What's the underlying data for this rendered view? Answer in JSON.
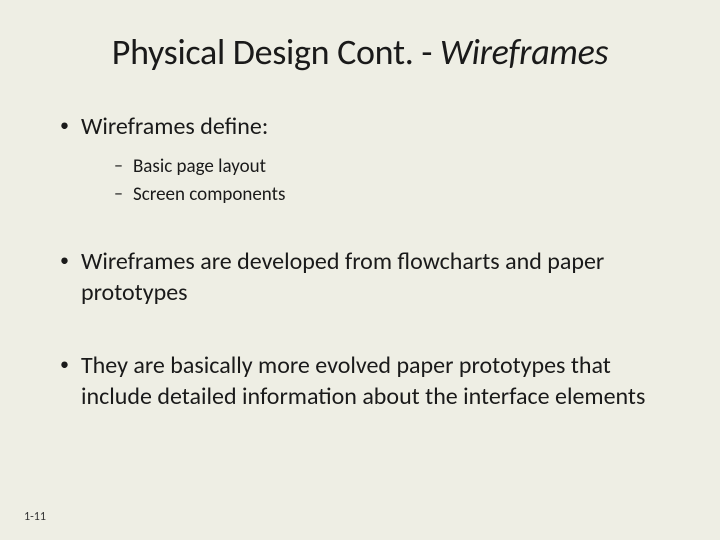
{
  "slide": {
    "title_regular": "Physical Design Cont. - ",
    "title_italic": "Wireframes",
    "bullets": [
      {
        "text": "Wireframes define:",
        "subs": [
          "Basic page layout",
          "Screen components"
        ]
      },
      {
        "text": "Wireframes are developed from flowcharts and paper prototypes"
      },
      {
        "text": "They are basically more evolved paper prototypes that include detailed information about the interface elements"
      }
    ],
    "page_number": "1-11"
  }
}
